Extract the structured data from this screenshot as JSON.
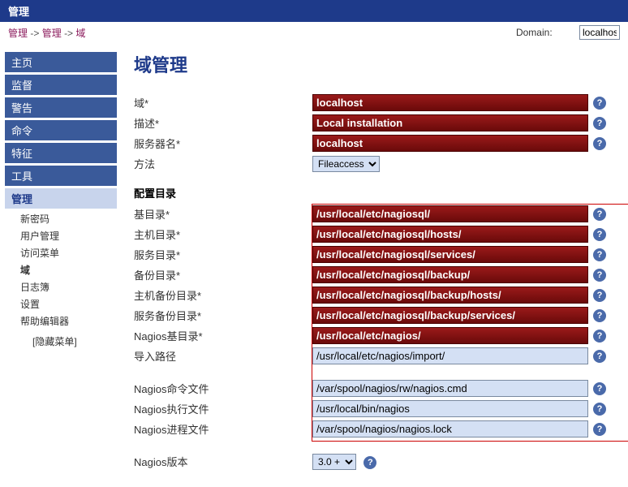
{
  "top_bar": {
    "title": "管理"
  },
  "breadcrumb": {
    "items": [
      "管理",
      "管理",
      "域"
    ],
    "sep": " -> ",
    "domain_label": "Domain:",
    "domain_value": "localhos"
  },
  "sidebar": {
    "items": [
      {
        "label": "主页",
        "active": false
      },
      {
        "label": "监督",
        "active": false
      },
      {
        "label": "警告",
        "active": false
      },
      {
        "label": "命令",
        "active": false
      },
      {
        "label": "特征",
        "active": false
      },
      {
        "label": "工具",
        "active": false
      },
      {
        "label": "管理",
        "active": true
      }
    ],
    "sub_items": [
      {
        "label": "新密码",
        "bold": false
      },
      {
        "label": "用户管理",
        "bold": false
      },
      {
        "label": "访问菜单",
        "bold": false
      },
      {
        "label": "域",
        "bold": true
      },
      {
        "label": "日志簿",
        "bold": false
      },
      {
        "label": "设置",
        "bold": false
      },
      {
        "label": "帮助编辑器",
        "bold": false
      }
    ],
    "hide_menu": "[隐藏菜单]"
  },
  "content": {
    "page_title": "域管理",
    "fields": {
      "domain": {
        "label": "域*",
        "value": "localhost",
        "error": true
      },
      "description": {
        "label": "描述*",
        "value": "Local installation",
        "error": true
      },
      "server_name": {
        "label": "服务器名*",
        "value": "localhost",
        "error": true
      },
      "method": {
        "label": "方法",
        "options": [
          "Fileaccess"
        ],
        "selected": "Fileaccess"
      }
    },
    "config_section": "配置目录",
    "config_fields": {
      "base_dir": {
        "label": "基目录*",
        "value": "/usr/local/etc/nagiosql/",
        "error": true
      },
      "host_dir": {
        "label": "主机目录*",
        "value": "/usr/local/etc/nagiosql/hosts/",
        "error": true
      },
      "service_dir": {
        "label": "服务目录*",
        "value": "/usr/local/etc/nagiosql/services/",
        "error": true
      },
      "backup_dir": {
        "label": "备份目录*",
        "value": "/usr/local/etc/nagiosql/backup/",
        "error": true
      },
      "host_backup_dir": {
        "label": "主机备份目录*",
        "value": "/usr/local/etc/nagiosql/backup/hosts/",
        "error": true
      },
      "service_backup_dir": {
        "label": "服务备份目录*",
        "value": "/usr/local/etc/nagiosql/backup/services/",
        "error": true
      },
      "nagios_base_dir": {
        "label": "Nagios基目录*",
        "value": "/usr/local/etc/nagios/",
        "error": true
      },
      "import_path": {
        "label": "导入路径",
        "value": "/usr/local/etc/nagios/import/",
        "error": false
      }
    },
    "nagios_fields": {
      "cmd_file": {
        "label": "Nagios命令文件",
        "value": "/var/spool/nagios/rw/nagios.cmd",
        "error": false
      },
      "exec_file": {
        "label": "Nagios执行文件",
        "value": "/usr/local/bin/nagios",
        "error": false
      },
      "proc_file": {
        "label": "Nagios进程文件",
        "value": "/var/spool/nagios/nagios.lock",
        "error": false
      }
    },
    "version": {
      "label": "Nagios版本",
      "options": [
        "3.0 +"
      ],
      "selected": "3.0 +"
    }
  }
}
